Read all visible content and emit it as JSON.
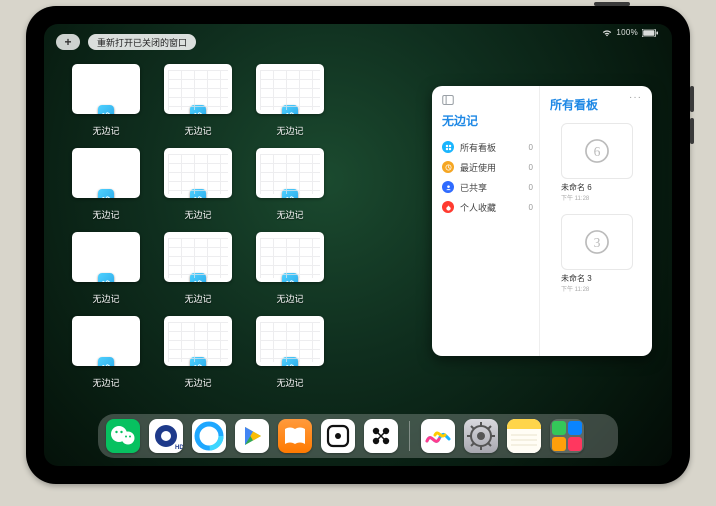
{
  "statusbar": {
    "battery_text": "100%"
  },
  "top": {
    "plus": "+",
    "reopen_label": "重新打开已关闭的窗口"
  },
  "mission_control": {
    "window_label": "无边记",
    "windows": [
      {
        "variant": "blank"
      },
      {
        "variant": "detail"
      },
      {
        "variant": "detail"
      },
      null,
      {
        "variant": "blank"
      },
      {
        "variant": "detail"
      },
      {
        "variant": "detail"
      },
      null,
      {
        "variant": "blank"
      },
      {
        "variant": "detail"
      },
      {
        "variant": "detail"
      },
      null,
      {
        "variant": "blank"
      },
      {
        "variant": "detail"
      },
      {
        "variant": "detail"
      },
      null
    ]
  },
  "panel": {
    "app_title": "无边记",
    "more": "···",
    "items": [
      {
        "label": "所有看板",
        "count": "0",
        "color": "#19b5fe"
      },
      {
        "label": "最近使用",
        "count": "0",
        "color": "#f5a623"
      },
      {
        "label": "已共享",
        "count": "0",
        "color": "#2f6bff"
      },
      {
        "label": "个人收藏",
        "count": "0",
        "color": "#ff3b30"
      }
    ],
    "boards_title": "所有看板",
    "boards": [
      {
        "title": "未命名 6",
        "sub": "下午 11:28",
        "digit": "6"
      },
      {
        "title": "未命名 3",
        "sub": "下午 11:28",
        "digit": "3"
      }
    ]
  },
  "dock": {
    "apps_left": [
      {
        "name": "wechat-app"
      },
      {
        "name": "qq-app"
      },
      {
        "name": "qq-browser-app"
      },
      {
        "name": "play-app"
      },
      {
        "name": "books-app"
      },
      {
        "name": "dice-app"
      },
      {
        "name": "dots-app"
      }
    ],
    "apps_right": [
      {
        "name": "freeform-app"
      },
      {
        "name": "settings-app"
      },
      {
        "name": "notes-app"
      },
      {
        "name": "app-library"
      }
    ]
  }
}
